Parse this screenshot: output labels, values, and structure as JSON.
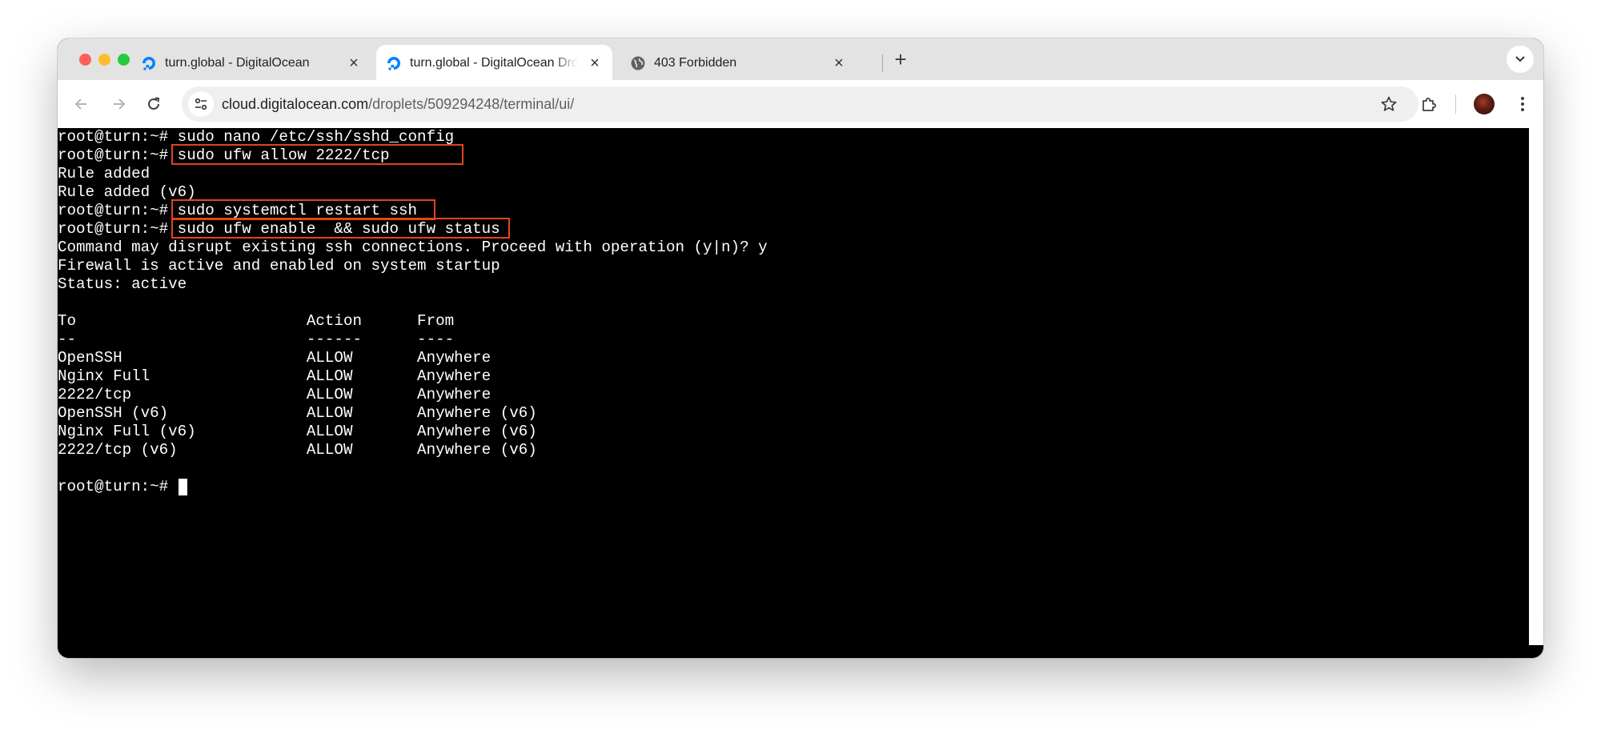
{
  "browser": {
    "tabs": [
      {
        "title": "turn.global - DigitalOcean",
        "icon": "digitalocean-icon",
        "active": false
      },
      {
        "title": "turn.global - DigitalOcean Droplets",
        "icon": "digitalocean-icon",
        "active": true
      },
      {
        "title": "403 Forbidden",
        "icon": "globe-icon",
        "active": false
      }
    ],
    "address": {
      "host": "cloud.digitalocean.com",
      "path": "/droplets/509294248/terminal/ui/"
    }
  },
  "terminal": {
    "lines": [
      "root@turn:~# sudo nano /etc/ssh/sshd_config",
      "root@turn:~# sudo ufw allow 2222/tcp",
      "Rule added",
      "Rule added (v6)",
      "root@turn:~# sudo systemctl restart ssh",
      "root@turn:~# sudo ufw enable  && sudo ufw status",
      "Command may disrupt existing ssh connections. Proceed with operation (y|n)? y",
      "Firewall is active and enabled on system startup",
      "Status: active",
      "",
      "To                         Action      From",
      "--                         ------      ----",
      "OpenSSH                    ALLOW       Anywhere",
      "Nginx Full                 ALLOW       Anywhere",
      "2222/tcp                   ALLOW       Anywhere",
      "OpenSSH (v6)               ALLOW       Anywhere (v6)",
      "Nginx Full (v6)            ALLOW       Anywhere (v6)",
      "2222/tcp (v6)              ALLOW       Anywhere (v6)",
      "",
      "root@turn:~# "
    ],
    "highlight_color": "#e1451b"
  }
}
